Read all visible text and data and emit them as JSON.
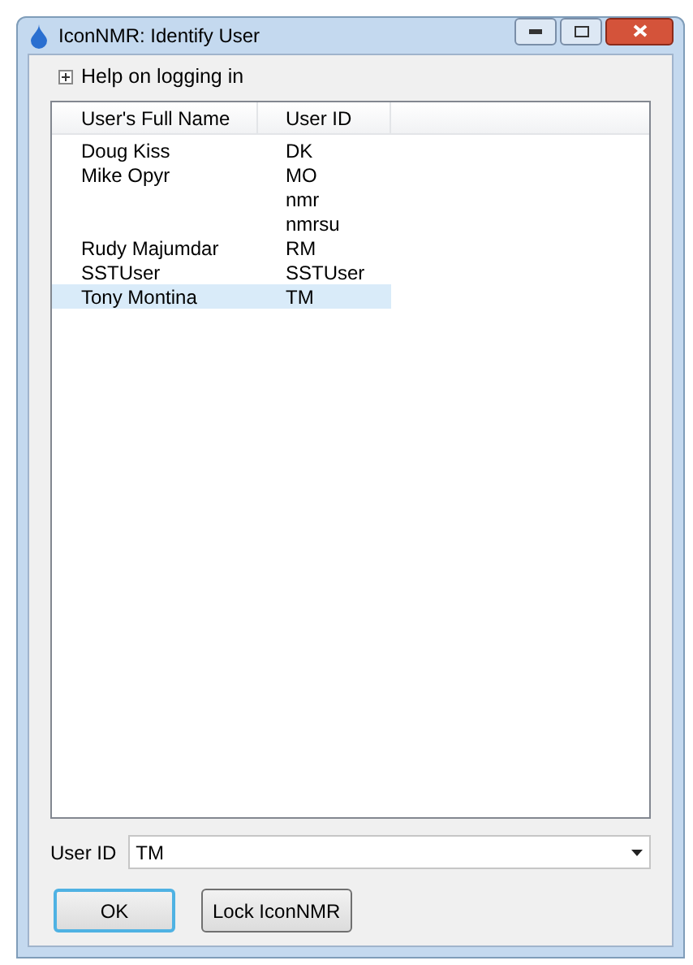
{
  "window": {
    "title": "IconNMR: Identify User"
  },
  "help": {
    "label": "Help on logging in",
    "expanded": false
  },
  "table": {
    "columns": [
      "User's Full Name",
      "User ID"
    ],
    "rows": [
      {
        "name": "Doug Kiss",
        "id": "DK",
        "selected": false
      },
      {
        "name": "Mike Opyr",
        "id": "MO",
        "selected": false
      },
      {
        "name": "",
        "id": "nmr",
        "selected": false
      },
      {
        "name": "",
        "id": "nmrsu",
        "selected": false
      },
      {
        "name": "Rudy Majumdar",
        "id": "RM",
        "selected": false
      },
      {
        "name": "SSTUser",
        "id": "SSTUser",
        "selected": false
      },
      {
        "name": "Tony Montina",
        "id": "TM",
        "selected": true
      }
    ]
  },
  "user_id": {
    "label": "User ID",
    "value": "TM"
  },
  "buttons": [
    {
      "label": "OK",
      "default": true
    },
    {
      "label": "Lock IconNMR",
      "default": false
    }
  ]
}
